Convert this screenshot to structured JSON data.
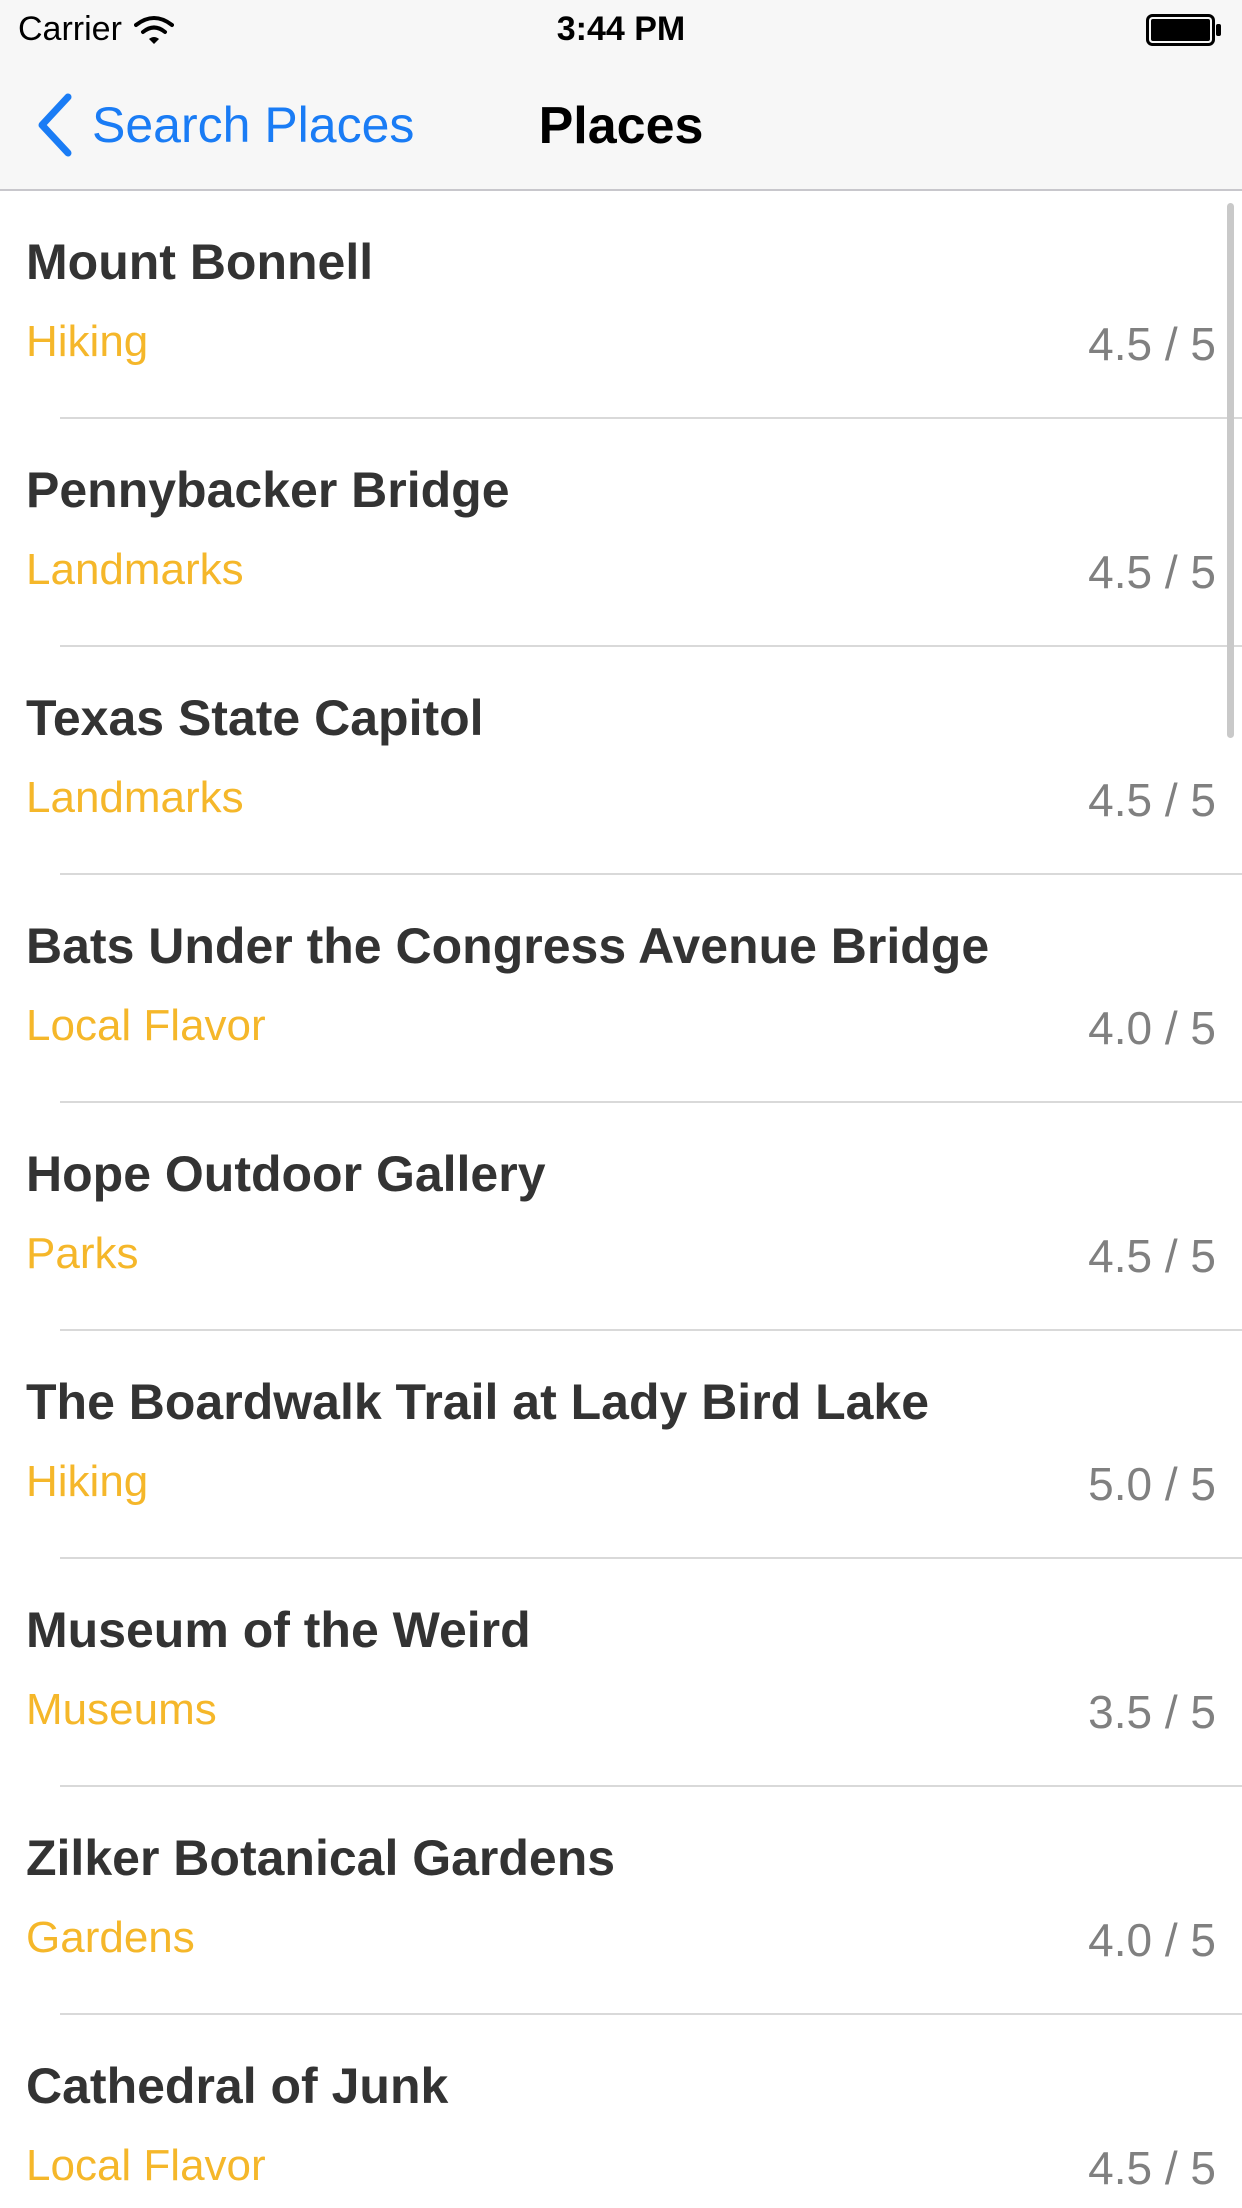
{
  "status_bar": {
    "carrier": "Carrier",
    "time": "3:44 PM",
    "wifi_icon": "wifi-icon",
    "battery_icon": "battery-icon"
  },
  "nav": {
    "back_label": "Search Places",
    "back_icon": "chevron-left-icon",
    "title": "Places"
  },
  "colors": {
    "accent": "#1a7cf5",
    "category": "#f5b72a",
    "rating": "#808080",
    "title_text": "#333333"
  },
  "places": [
    {
      "name": "Mount Bonnell",
      "category": "Hiking",
      "rating": "4.5 / 5"
    },
    {
      "name": "Pennybacker Bridge",
      "category": "Landmarks",
      "rating": "4.5 / 5"
    },
    {
      "name": "Texas State Capitol",
      "category": "Landmarks",
      "rating": "4.5 / 5"
    },
    {
      "name": "Bats Under the Congress Avenue Bridge",
      "category": "Local Flavor",
      "rating": "4.0 / 5"
    },
    {
      "name": "Hope Outdoor Gallery",
      "category": "Parks",
      "rating": "4.5 / 5"
    },
    {
      "name": "The Boardwalk Trail at Lady Bird Lake",
      "category": "Hiking",
      "rating": "5.0 / 5"
    },
    {
      "name": "Museum of the Weird",
      "category": "Museums",
      "rating": "3.5 / 5"
    },
    {
      "name": "Zilker Botanical Gardens",
      "category": "Gardens",
      "rating": "4.0 / 5"
    },
    {
      "name": "Cathedral of Junk",
      "category": "Local Flavor",
      "rating": "4.5 / 5"
    }
  ]
}
